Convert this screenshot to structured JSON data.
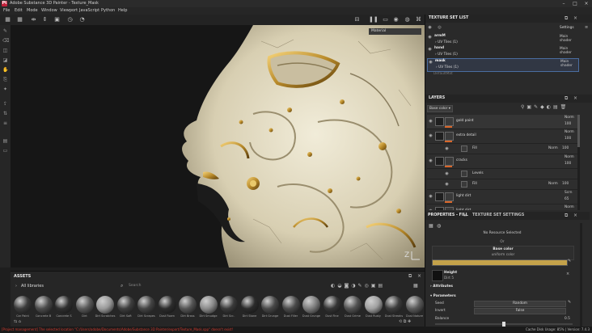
{
  "window": {
    "title": "Adobe Substance 3D Painter - Texture_Mask",
    "logo": "Pt"
  },
  "menu": [
    "File",
    "Edit",
    "Mode",
    "Window",
    "Viewport",
    "JavaScript",
    "Python",
    "Help"
  ],
  "viewport": {
    "material_tag": "Material"
  },
  "texture_set_list": {
    "title": "TEXTURE SET LIST",
    "settings_label": "Settings",
    "sets": [
      {
        "name": "armM",
        "shader": "Main shader",
        "uv": "UV Tiles (1)"
      },
      {
        "name": "hand",
        "shader": "Main shader",
        "uv": "UV Tiles (1)"
      },
      {
        "name": "mask",
        "shader": "Main shader",
        "uv": "UV Tiles (1)"
      }
    ],
    "unassigned": "DefaultMat"
  },
  "layers": {
    "title": "LAYERS",
    "blend_select": "Base color",
    "items": [
      {
        "name": "gold paint",
        "blend": "Norm",
        "opacity": "100"
      },
      {
        "name": "extra detail",
        "blend": "Norm",
        "opacity": "100"
      },
      {
        "name": "Fill",
        "blend": "Norm",
        "opacity": "100",
        "sub": true
      },
      {
        "name": "cracks",
        "blend": "Norm",
        "opacity": "100"
      },
      {
        "name": "Levels",
        "blend": "",
        "opacity": "",
        "sub": true
      },
      {
        "name": "Fill",
        "blend": "Norm",
        "opacity": "100",
        "sub": true
      },
      {
        "name": "light dirt",
        "blend": "Scrn",
        "opacity": "65"
      },
      {
        "name": "light dirt",
        "blend": "Norm",
        "opacity": "65"
      }
    ]
  },
  "properties": {
    "tab1": "PROPERTIES - FILL",
    "tab2": "TEXTURE SET SETTINGS",
    "no_resource": "No Resource Selected",
    "or_label": "Or",
    "base_color_label": "Base color",
    "base_color_sub": "uniform color",
    "base_color_hex": "#c4a24a",
    "height_label": "Height",
    "height_sub": "Dirt 5",
    "attributes_label": "Attributes",
    "parameters_label": "Parameters",
    "seed_label": "Seed",
    "seed_value": "Random",
    "invert_label": "Invert",
    "invert_value": "False",
    "balance_label": "Balance",
    "balance_value": "0.5"
  },
  "assets": {
    "title": "ASSETS",
    "library": "All libraries",
    "search_placeholder": "Search",
    "items": [
      "Car Paint",
      "Concrete B",
      "Concrete S",
      "Dirt",
      "Dirt Scratches",
      "Dirt Soft",
      "Dirt Scrapes",
      "Dust Foam",
      "Dirt Brass",
      "Dirt Smudge",
      "Dirt Scr..",
      "Dirt Stone",
      "Dirt Grunge",
      "Dust Filler",
      "Dust Grunge",
      "Dust Fine",
      "Dust Grime",
      "Dust Rusty",
      "Dust Streaks",
      "Dust Nature"
    ],
    "colors": [
      "#3b3b3b",
      "#4b4b4b",
      "#2f2f2f",
      "#595959",
      "#9a9a9a",
      "#3e3e3e",
      "#444",
      "#2c2c2c",
      "#555",
      "#8b8b8b",
      "#3a3a3a",
      "#2b2b2b",
      "#484848",
      "#4a4a4a",
      "#7d7d7d",
      "#353535",
      "#525252",
      "#a0a0a0",
      "#3c3c3c",
      "#5a5a5a"
    ]
  },
  "status": {
    "message": "[Project management] The selected location \"C:/Users/adobe/Documents/Adobe/Substance 3D Painter/export/Texture_Mask.spp\" doesn't exist!",
    "cache": "Cache Disk Usage:  85% | Version: 7.4.3"
  }
}
